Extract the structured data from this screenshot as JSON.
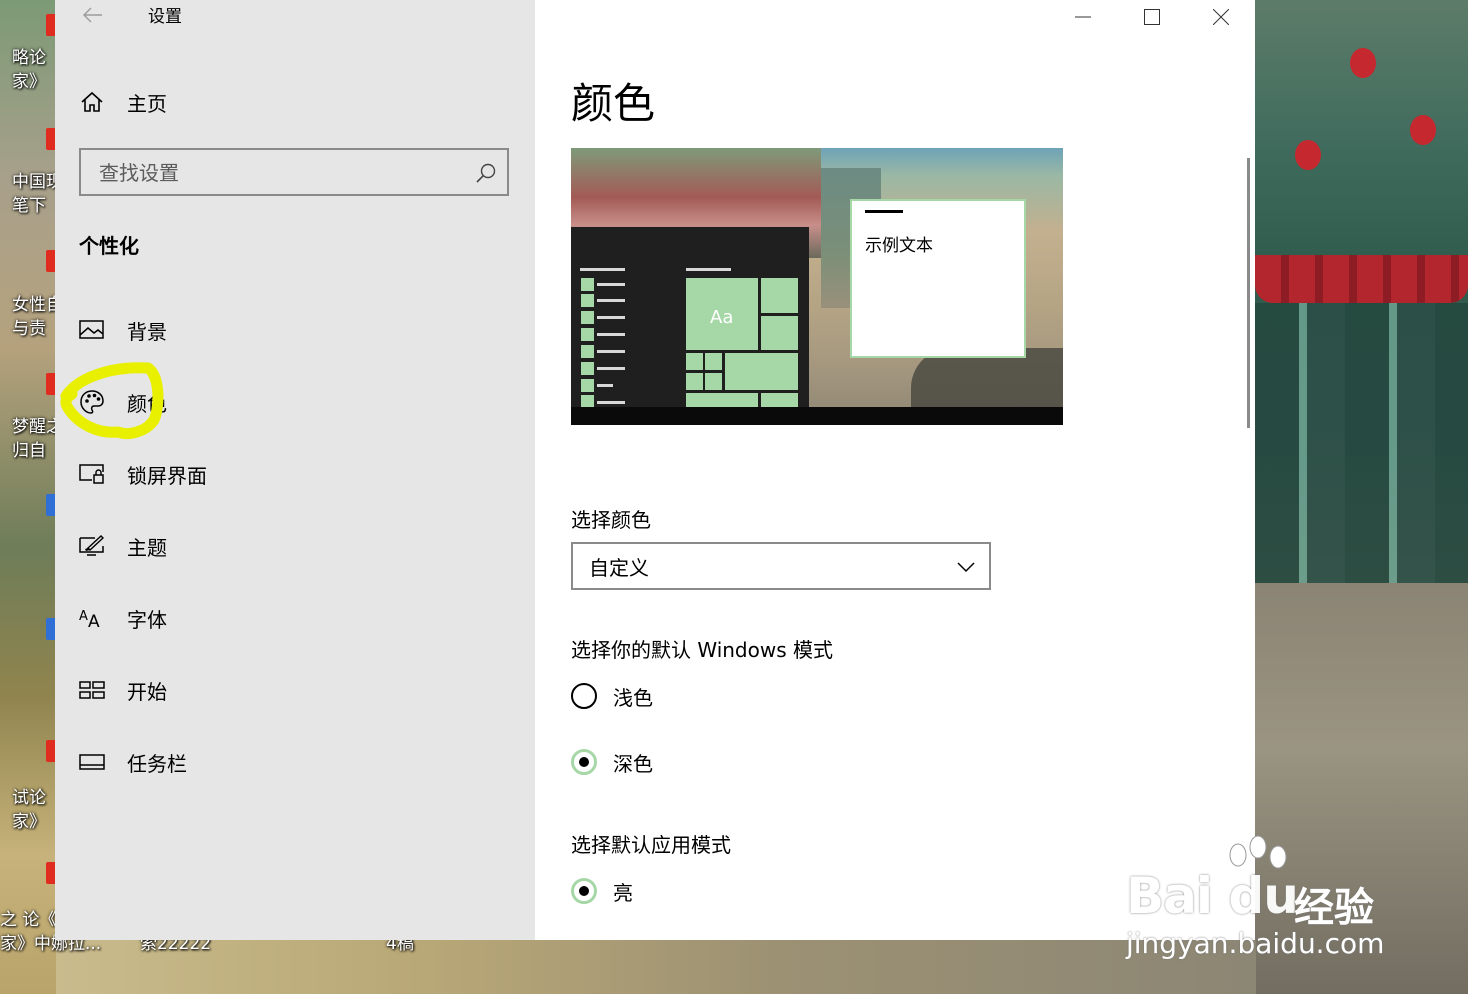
{
  "window": {
    "title": "设置"
  },
  "sidebar": {
    "home_label": "主页",
    "search_placeholder": "查找设置",
    "section_title": "个性化",
    "items": [
      {
        "label": "背景",
        "icon": "image-icon"
      },
      {
        "label": "颜色",
        "icon": "palette-icon",
        "selected": true
      },
      {
        "label": "锁屏界面",
        "icon": "lock-screen-icon"
      },
      {
        "label": "主题",
        "icon": "theme-icon"
      },
      {
        "label": "字体",
        "icon": "font-icon"
      },
      {
        "label": "开始",
        "icon": "start-icon"
      },
      {
        "label": "任务栏",
        "icon": "taskbar-icon"
      }
    ]
  },
  "main": {
    "title": "颜色",
    "preview": {
      "sample_text": "示例文本",
      "tile_text": "Aa"
    },
    "choose_color": {
      "label": "选择颜色",
      "value": "自定义"
    },
    "windows_mode": {
      "label": "选择你的默认 Windows 模式",
      "options": [
        {
          "label": "浅色",
          "checked": false
        },
        {
          "label": "深色",
          "checked": true
        }
      ]
    },
    "app_mode": {
      "label": "选择默认应用模式",
      "options": [
        {
          "label": "亮",
          "checked": true
        }
      ]
    }
  },
  "desktop": {
    "icon_labels": [
      "略论\n家》",
      "中国现\n笔下",
      "女性自\n与责",
      "梦醒之\n归自",
      "试论\n家》",
      "之 论《\n家》中娜拉...",
      "索22222",
      "4稿"
    ]
  },
  "watermark": {
    "logo": "Bai  du",
    "brand_cn": "经验",
    "url": "jingyan.baidu.com"
  },
  "colors": {
    "accent": "#a6d7a6",
    "sidebar_bg": "#e6e6e6",
    "highlight": "#e8f000"
  }
}
